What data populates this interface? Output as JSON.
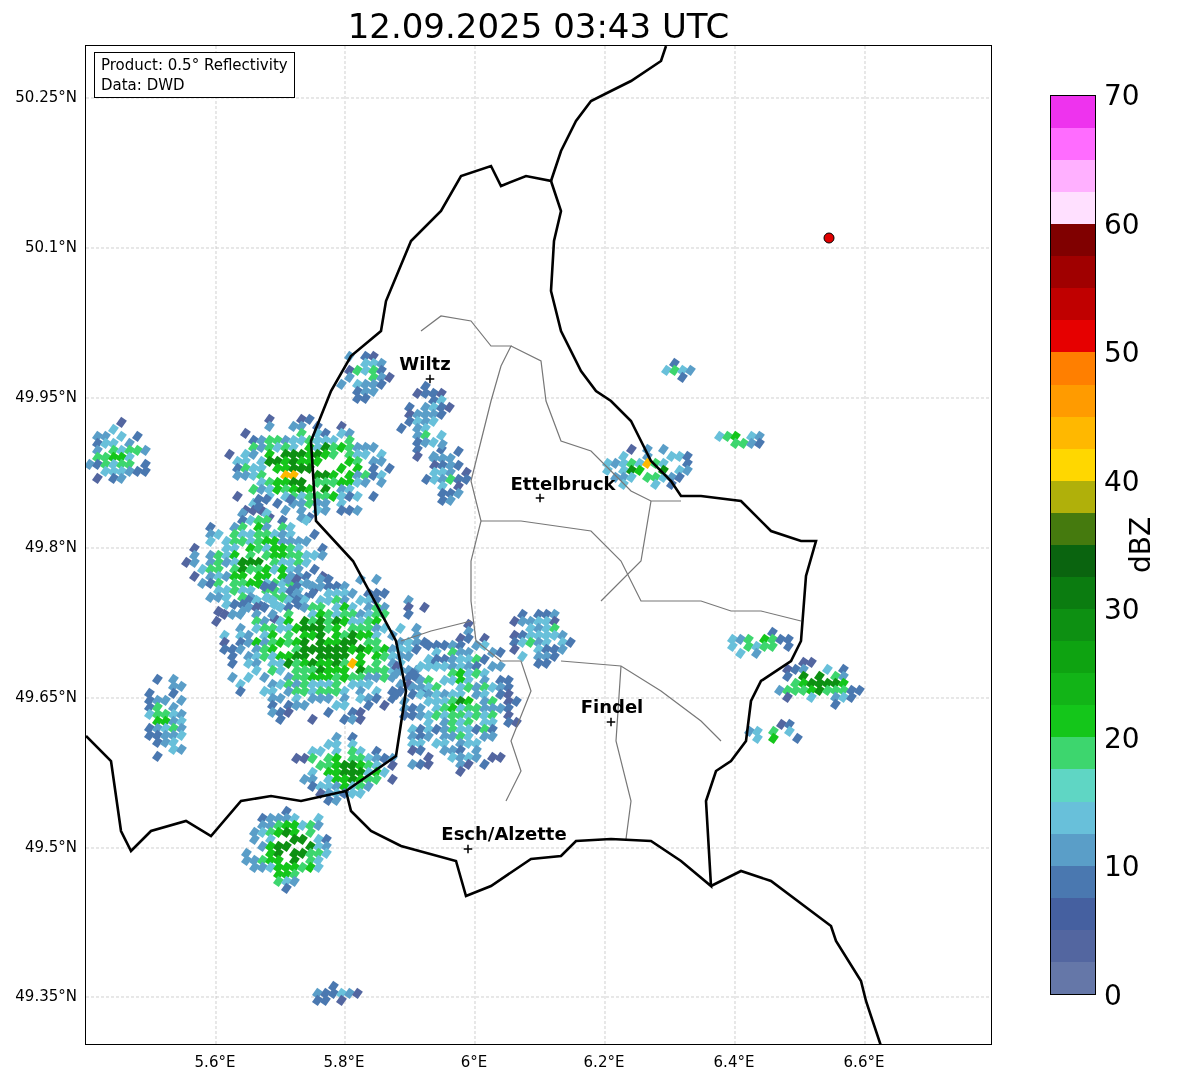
{
  "title": "12.09.2025 03:43 UTC",
  "info_box": [
    "Product: 0.5° Reflectivity",
    "Data: DWD"
  ],
  "cities": [
    "Wiltz",
    "Ettelbruck",
    "Findel",
    "Esch/Alzette"
  ],
  "y_ticks": [
    "50.25°N",
    "50.1°N",
    "49.95°N",
    "49.8°N",
    "49.65°N",
    "49.5°N",
    "49.35°N"
  ],
  "x_ticks": [
    "5.6°E",
    "5.8°E",
    "6°E",
    "6.2°E",
    "6.4°E",
    "6.6°E"
  ],
  "colorbar": {
    "label": "dBZ",
    "ticks": [
      "70",
      "60",
      "50",
      "40",
      "30",
      "20",
      "10",
      "0"
    ]
  }
}
